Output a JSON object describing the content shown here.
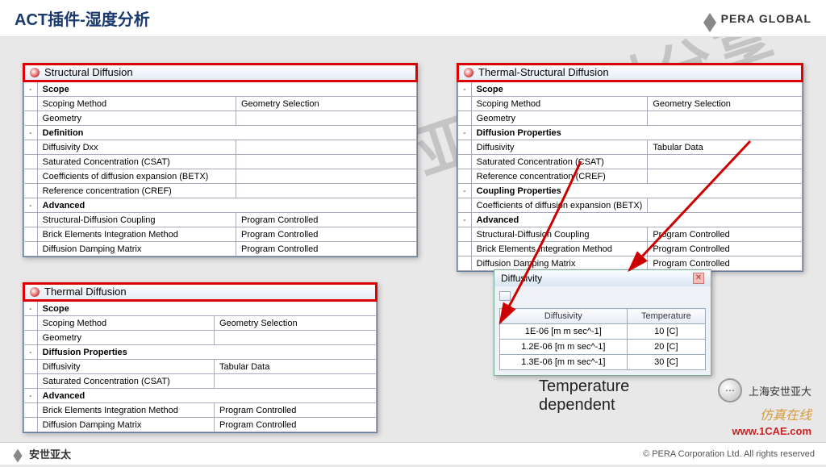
{
  "header": {
    "title": "ACT插件-湿度分析",
    "brand": "PERA GLOBAL"
  },
  "panel1": {
    "title": "Structural Diffusion",
    "rows": [
      {
        "t": "-",
        "a": "Scope",
        "b": "",
        "sec": true
      },
      {
        "t": "",
        "a": "Scoping Method",
        "b": "Geometry Selection"
      },
      {
        "t": "",
        "a": "Geometry",
        "b": "",
        "hl": true
      },
      {
        "t": "-",
        "a": "Definition",
        "b": "",
        "sec": true
      },
      {
        "t": "",
        "a": "Diffusivity Dxx",
        "b": "",
        "hl": true
      },
      {
        "t": "",
        "a": "Saturated Concentration (CSAT)",
        "b": "",
        "hl": true
      },
      {
        "t": "",
        "a": "Coefficients of diffusion expansion (BETX)",
        "b": "",
        "hl": true
      },
      {
        "t": "",
        "a": "Reference concentration (CREF)",
        "b": "",
        "hl": true
      },
      {
        "t": "-",
        "a": "Advanced",
        "b": "",
        "sec": true
      },
      {
        "t": "",
        "a": "Structural-Diffusion Coupling",
        "b": "Program Controlled"
      },
      {
        "t": "",
        "a": "Brick Elements Integration Method",
        "b": "Program Controlled"
      },
      {
        "t": "",
        "a": "Diffusion Damping Matrix",
        "b": "Program Controlled"
      }
    ]
  },
  "panel2": {
    "title": "Thermal-Structural Diffusion",
    "rows": [
      {
        "t": "-",
        "a": "Scope",
        "b": "",
        "sec": true
      },
      {
        "t": "",
        "a": "Scoping Method",
        "b": "Geometry Selection"
      },
      {
        "t": "",
        "a": "Geometry",
        "b": "",
        "hl": true
      },
      {
        "t": "-",
        "a": "Diffusion Properties",
        "b": "",
        "sec": true
      },
      {
        "t": "",
        "a": "Diffusivity",
        "b": "Tabular Data",
        "hl": true
      },
      {
        "t": "",
        "a": "Saturated Concentration (CSAT)",
        "b": "",
        "hl": true
      },
      {
        "t": "",
        "a": "Reference concentration (CREF)",
        "b": "",
        "hl": true
      },
      {
        "t": "-",
        "a": "Coupling Properties",
        "b": "",
        "sec": true
      },
      {
        "t": "",
        "a": "Coefficients of diffusion expansion (BETX)",
        "b": "",
        "hl": true
      },
      {
        "t": "-",
        "a": "Advanced",
        "b": "",
        "sec": true
      },
      {
        "t": "",
        "a": "Structural-Diffusion Coupling",
        "b": "Program Controlled"
      },
      {
        "t": "",
        "a": "Brick Elements Integration Method",
        "b": "Program Controlled"
      },
      {
        "t": "",
        "a": "Diffusion Damping Matrix",
        "b": "Program Controlled"
      }
    ]
  },
  "panel3": {
    "title": "Thermal Diffusion",
    "rows": [
      {
        "t": "-",
        "a": "Scope",
        "b": "",
        "sec": true
      },
      {
        "t": "",
        "a": "Scoping Method",
        "b": "Geometry Selection"
      },
      {
        "t": "",
        "a": "Geometry",
        "b": "",
        "hl": true
      },
      {
        "t": "-",
        "a": "Diffusion Properties",
        "b": "",
        "sec": true
      },
      {
        "t": "",
        "a": "Diffusivity",
        "b": "Tabular Data",
        "hl": true
      },
      {
        "t": "",
        "a": "Saturated Concentration (CSAT)",
        "b": "",
        "hl": true
      },
      {
        "t": "-",
        "a": "Advanced",
        "b": "",
        "sec": true
      },
      {
        "t": "",
        "a": "Brick Elements Integration Method",
        "b": "Program Controlled"
      },
      {
        "t": "",
        "a": "Diffusion Damping Matrix",
        "b": "Program Controlled"
      }
    ]
  },
  "popup": {
    "title": "Diffusivity",
    "cols": [
      "Diffusivity",
      "Temperature"
    ],
    "rows": [
      [
        "1E-06 [m m sec^-1]",
        "10 [C]"
      ],
      [
        "1.2E-06 [m m sec^-1]",
        "20 [C]"
      ],
      [
        "1.3E-06 [m m sec^-1]",
        "30 [C]"
      ]
    ]
  },
  "label": "Temperature\ndependent",
  "footer": {
    "left": "安世亚太",
    "right": "©   PERA Corporation Ltd. All rights reserved"
  },
  "overlay": {
    "cn": "上海安世亚大",
    "it": "仿真在线",
    "url": "www.1CAE.com"
  },
  "watermark": "上海安世亚太资料分享"
}
